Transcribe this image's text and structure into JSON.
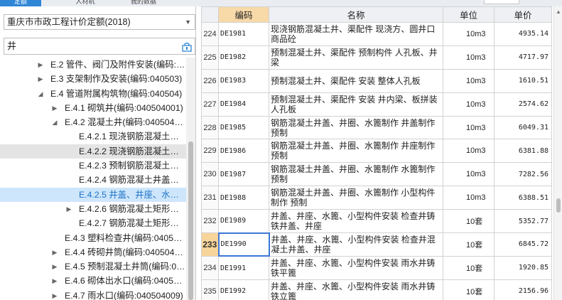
{
  "tabs": [
    {
      "label": "定额",
      "active": true
    },
    {
      "label": "人材机",
      "active": false
    },
    {
      "label": "我的数据",
      "active": false
    }
  ],
  "left": {
    "quota_select": "重庆市市政工程计价定额(2018)",
    "search_value": "井",
    "tree": [
      {
        "label": "E.2 管件、阀门及附件安装(编码:…",
        "expanded": false,
        "state": ""
      },
      {
        "label": "E.3 支架制作及安装(编码:040503)",
        "expanded": false,
        "state": ""
      },
      {
        "label": "E.4 管道附属构筑物(编码:040504)",
        "expanded": true,
        "state": ""
      },
      {
        "label": "E.4.1 砌筑井(编码:040504001)",
        "expanded": false,
        "state": ""
      },
      {
        "label": "E.4.2 混凝土井(编码:040504…",
        "expanded": true,
        "state": ""
      },
      {
        "label": "E.4.2.1 现浇钢筋混凝土…",
        "expanded": null,
        "state": ""
      },
      {
        "label": "E.4.2.2 现浇钢筋混凝土…",
        "expanded": null,
        "state": "grey"
      },
      {
        "label": "E.4.2.3 预制钢筋混凝土…",
        "expanded": null,
        "state": ""
      },
      {
        "label": "E.4.2.4 钢筋混凝土井盖…",
        "expanded": null,
        "state": ""
      },
      {
        "label": "E.4.2.5 井盖、井座、水…",
        "expanded": null,
        "state": "blue"
      },
      {
        "label": "E.4.2.6 钢筋混凝土矩形…",
        "expanded": false,
        "state": ""
      },
      {
        "label": "E.4.2.7 钢筋混凝土矩形…",
        "expanded": null,
        "state": ""
      },
      {
        "label": "E.4.3 塑料检查井(编码:0405…",
        "expanded": null,
        "state": ""
      },
      {
        "label": "E.4.4 砖砌井筒(编码:040504…",
        "expanded": false,
        "state": ""
      },
      {
        "label": "E.4.5 预制混凝土井筒(编码:0…",
        "expanded": false,
        "state": ""
      },
      {
        "label": "E.4.6 砌体出水口(编码:0405…",
        "expanded": false,
        "state": ""
      },
      {
        "label": "E.4.7 雨水口(编码:040504009)",
        "expanded": false,
        "state": ""
      }
    ]
  },
  "grid": {
    "headers": {
      "idx": "",
      "code": "编码",
      "name": "名称",
      "unit": "单位",
      "price": "单价"
    },
    "rows": [
      {
        "idx": "224",
        "code": "DE1981",
        "name": "现浇钢筋混凝土井、渠配件 现浇方、圆井口商品砼",
        "unit": "10m3",
        "price": "4935.14"
      },
      {
        "idx": "225",
        "code": "DE1982",
        "name": "预制混凝土井、渠配件 预制构件 人孔板、井梁",
        "unit": "10m3",
        "price": "4717.97"
      },
      {
        "idx": "226",
        "code": "DE1983",
        "name": "预制混凝土井、渠配件 安装 整体人孔板",
        "unit": "10m3",
        "price": "1610.51"
      },
      {
        "idx": "227",
        "code": "DE1984",
        "name": "预制混凝土井、渠配件 安装 井内梁、板拼装人孔板",
        "unit": "10m3",
        "price": "2574.62"
      },
      {
        "idx": "228",
        "code": "DE1985",
        "name": "钢筋混凝土井盖、井圈、水篦制作 井盖制作预制",
        "unit": "10m3",
        "price": "6049.31"
      },
      {
        "idx": "229",
        "code": "DE1986",
        "name": "钢筋混凝土井盖、井圈、水篦制作 井座制作预制",
        "unit": "10m3",
        "price": "6381.88"
      },
      {
        "idx": "230",
        "code": "DE1987",
        "name": "钢筋混凝土井盖、井圈、水篦制作 水篦制作预制",
        "unit": "10m3",
        "price": "7282.56"
      },
      {
        "idx": "231",
        "code": "DE1988",
        "name": "钢筋混凝土井盖、井圈、水篦制作 小型构件制作 预制",
        "unit": "10m3",
        "price": "6388.51"
      },
      {
        "idx": "232",
        "code": "DE1989",
        "name": "井盖、井座、水篦、小型构件安装 检查井铸铁井盖、井座",
        "unit": "10套",
        "price": "5352.77"
      },
      {
        "idx": "233",
        "code": "DE1990",
        "name": "井盖、井座、水篦、小型构件安装 检查井混凝土井盖、井座",
        "unit": "10套",
        "price": "6845.72"
      },
      {
        "idx": "234",
        "code": "DE1991",
        "name": "井盖、井座、水篦、小型构件安装 雨水井铸铁平篦",
        "unit": "10套",
        "price": "1920.85"
      },
      {
        "idx": "235",
        "code": "DE1992",
        "name": "井盖、井座、水篦、小型构件安装 雨水井铸铁立篦",
        "unit": "10套",
        "price": "2156.96"
      }
    ],
    "current_row_idx": "233"
  }
}
